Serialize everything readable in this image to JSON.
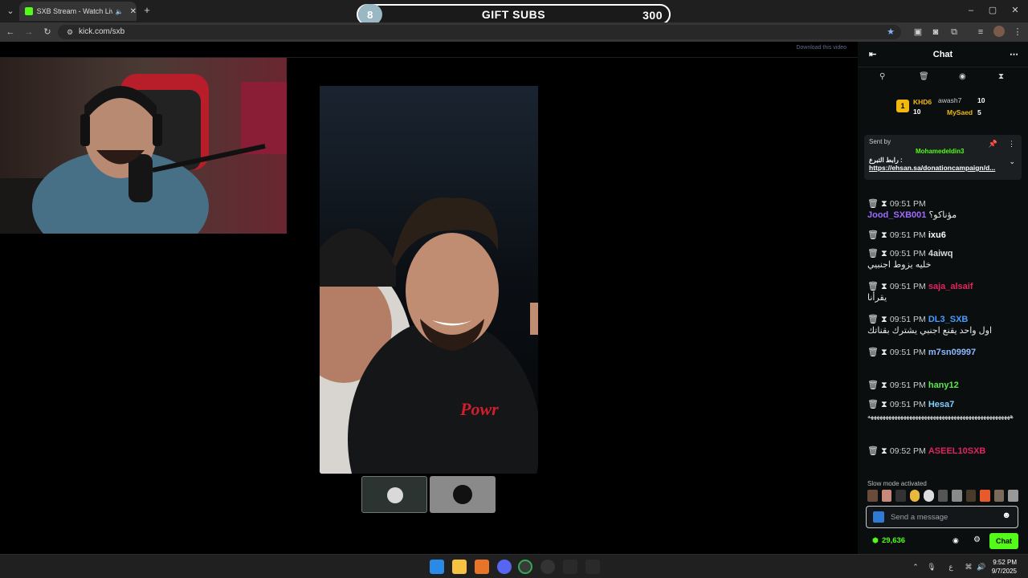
{
  "browser": {
    "tab_title": "SXB Stream - Watch Live on",
    "url": "kick.com/sxb",
    "colors": {
      "kick_green": "#53fc18"
    }
  },
  "overlay": {
    "gift_count": "8",
    "gift_label": "GIFT SUBS",
    "gift_goal": "300",
    "download_label": "Download this video"
  },
  "chat": {
    "title": "Chat",
    "leaderboard": [
      {
        "name": "KHD6",
        "badge": "10"
      },
      {
        "name": "awash7",
        "badge": "10"
      },
      {
        "name": "MySaed",
        "badge": "5"
      }
    ],
    "pinned": {
      "sent_by": "Sent by",
      "user": "Mohamedeldin3",
      "text": "رابط التبرع :",
      "link": "https://ehsan.sa/donationcampaign/d..."
    },
    "messages": [
      {
        "time": "09:51 PM",
        "user": "Jood_SXB001",
        "text": "مؤناكو؟",
        "color": "#9d6bff"
      },
      {
        "time": "09:51 PM",
        "user": "ixu6",
        "text": "",
        "color": "#ffffff"
      },
      {
        "time": "09:51 PM",
        "user": "4aiwq",
        "text": "خليه يزوط اجنبيي",
        "color": "#d9d9d9"
      },
      {
        "time": "09:51 PM",
        "user": "saja_alsaif",
        "text": "يقرأنا",
        "color": "#e0245e"
      },
      {
        "time": "09:51 PM",
        "user": "DL3_SXB",
        "text": "اول واحد يقنع اجنبي يشترك بقناتك",
        "color": "#4a9bff"
      },
      {
        "time": "09:51 PM",
        "user": "m7sn09997",
        "text": "",
        "color": "#8fb8ff"
      },
      {
        "time": "09:51 PM",
        "user": "hany12",
        "text": "",
        "color": "#58e84a"
      },
      {
        "time": "09:51 PM",
        "user": "Hesa7",
        "text": "ههههههههههههههههههههههههههههههههههههههههههههههههه",
        "color": "#7fd0ff"
      },
      {
        "time": "09:52 PM",
        "user": "ASEEL10SXB",
        "text": "",
        "color": "#e0245e"
      }
    ],
    "slow_mode": "Slow mode activated",
    "input_placeholder": "Send a message",
    "viewer_count": "29,636",
    "send_label": "Chat"
  },
  "taskbar": {
    "time": "9:52 PM",
    "date": "9/7/2025",
    "lang": "ع"
  }
}
